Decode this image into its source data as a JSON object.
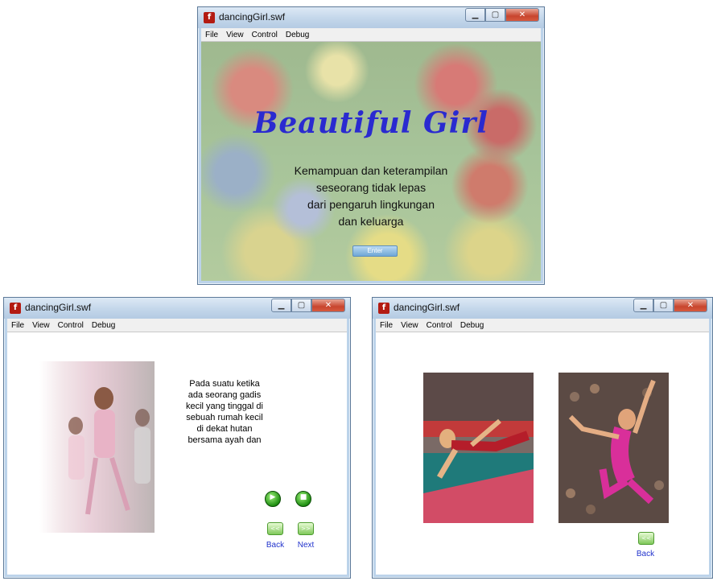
{
  "windows": [
    {
      "title": "dancingGirl.swf",
      "menu": [
        "File",
        "View",
        "Control",
        "Debug"
      ],
      "heading": "Beautiful Girl",
      "intro_text": "Kemampuan dan keterampilan\nseseorang tidak lepas\ndari pengaruh lingkungan\ndan keluarga",
      "enter_label": "Enter"
    },
    {
      "title": "dancingGirl.swf",
      "menu": [
        "File",
        "View",
        "Control",
        "Debug"
      ],
      "story_text": "Pada suatu ketika\nada seorang gadis\nkecil yang tinggal di\nsebuah rumah kecil\ndi dekat hutan\nbersama ayah dan",
      "back_label": "Back",
      "next_label": "Next",
      "back_icon": "<<",
      "next_icon": ">>"
    },
    {
      "title": "dancingGirl.swf",
      "menu": [
        "File",
        "View",
        "Control",
        "Debug"
      ],
      "back_label": "Back",
      "back_icon": "<<"
    }
  ],
  "colors": {
    "heading": "#2a2ad0",
    "nav_link": "#2233cc",
    "button_green": "#1f8f12",
    "titlebar": "#c3d6ea"
  }
}
